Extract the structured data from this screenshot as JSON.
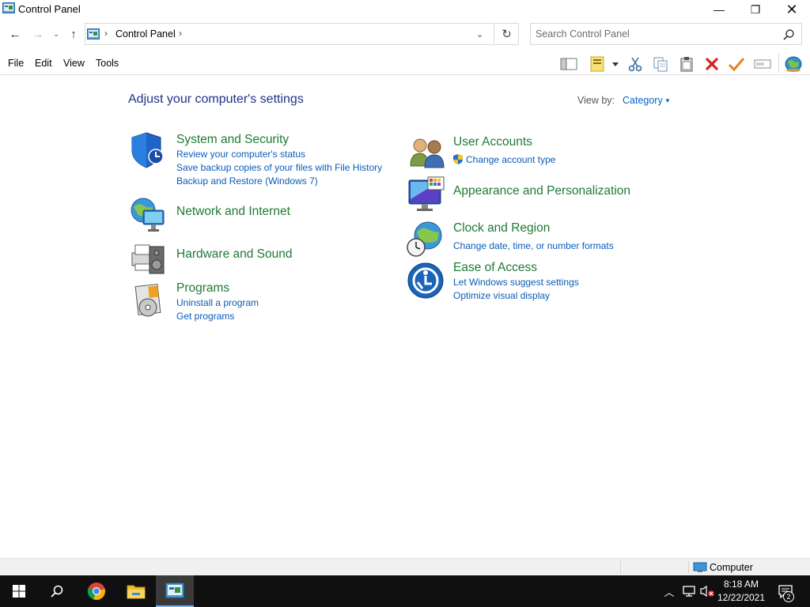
{
  "window": {
    "title": "Control Panel",
    "minimize_glyph": "—",
    "maximize_glyph": "❐",
    "close_glyph": "✕"
  },
  "nav": {
    "back_glyph": "←",
    "forward_glyph": "→",
    "recent_glyph": "⌄",
    "up_glyph": "↑",
    "address_sep": "›",
    "address_location": "Control Panel",
    "address_dropdown_glyph": "⌄",
    "refresh_glyph": "↻"
  },
  "search": {
    "placeholder": "Search Control Panel",
    "value": ""
  },
  "menu": {
    "items": [
      "File",
      "Edit",
      "View",
      "Tools"
    ]
  },
  "toolbar": {
    "icons": [
      "layout-icon",
      "properties-icon",
      "cut-icon",
      "copy-icon",
      "paste-icon",
      "delete-icon",
      "check-icon",
      "rename-icon",
      "globe-icon"
    ]
  },
  "main": {
    "title": "Adjust your computer's settings",
    "view_by_label": "View by:",
    "view_by_value": "Category",
    "categories": [
      {
        "id": "system-and-security",
        "title": "System and Security",
        "icon": "shield-icon",
        "links": [
          "Review your computer's status",
          "Save backup copies of your files with File History",
          "Backup and Restore (Windows 7)"
        ]
      },
      {
        "id": "network-and-internet",
        "title": "Network and Internet",
        "icon": "network-globe-icon",
        "links": []
      },
      {
        "id": "hardware-and-sound",
        "title": "Hardware and Sound",
        "icon": "printer-speaker-icon",
        "links": []
      },
      {
        "id": "programs",
        "title": "Programs",
        "icon": "programs-disc-icon",
        "links": [
          "Uninstall a program",
          "Get programs"
        ]
      },
      {
        "id": "user-accounts",
        "title": "User Accounts",
        "icon": "users-icon",
        "links": [
          "Change account type"
        ]
      },
      {
        "id": "appearance-and-personalization",
        "title": "Appearance and Personalization",
        "icon": "monitor-palette-icon",
        "links": []
      },
      {
        "id": "clock-and-region",
        "title": "Clock and Region",
        "icon": "clock-globe-icon",
        "links": [
          "Change date, time, or number formats"
        ]
      },
      {
        "id": "ease-of-access",
        "title": "Ease of Access",
        "icon": "ease-of-access-icon",
        "links": [
          "Let Windows suggest settings",
          "Optimize visual display"
        ]
      }
    ]
  },
  "statusbar": {
    "location": "Computer"
  },
  "taskbar": {
    "apps": [
      "start-icon",
      "search-icon",
      "chrome-icon",
      "file-explorer-icon",
      "control-panel-icon"
    ],
    "time": "8:18 AM",
    "date": "12/22/2021",
    "notification_count": "2"
  },
  "colors": {
    "category_title": "#1e7a35",
    "link": "#0a5cb8",
    "page_title": "#1e3287",
    "taskbar": "#101010"
  }
}
